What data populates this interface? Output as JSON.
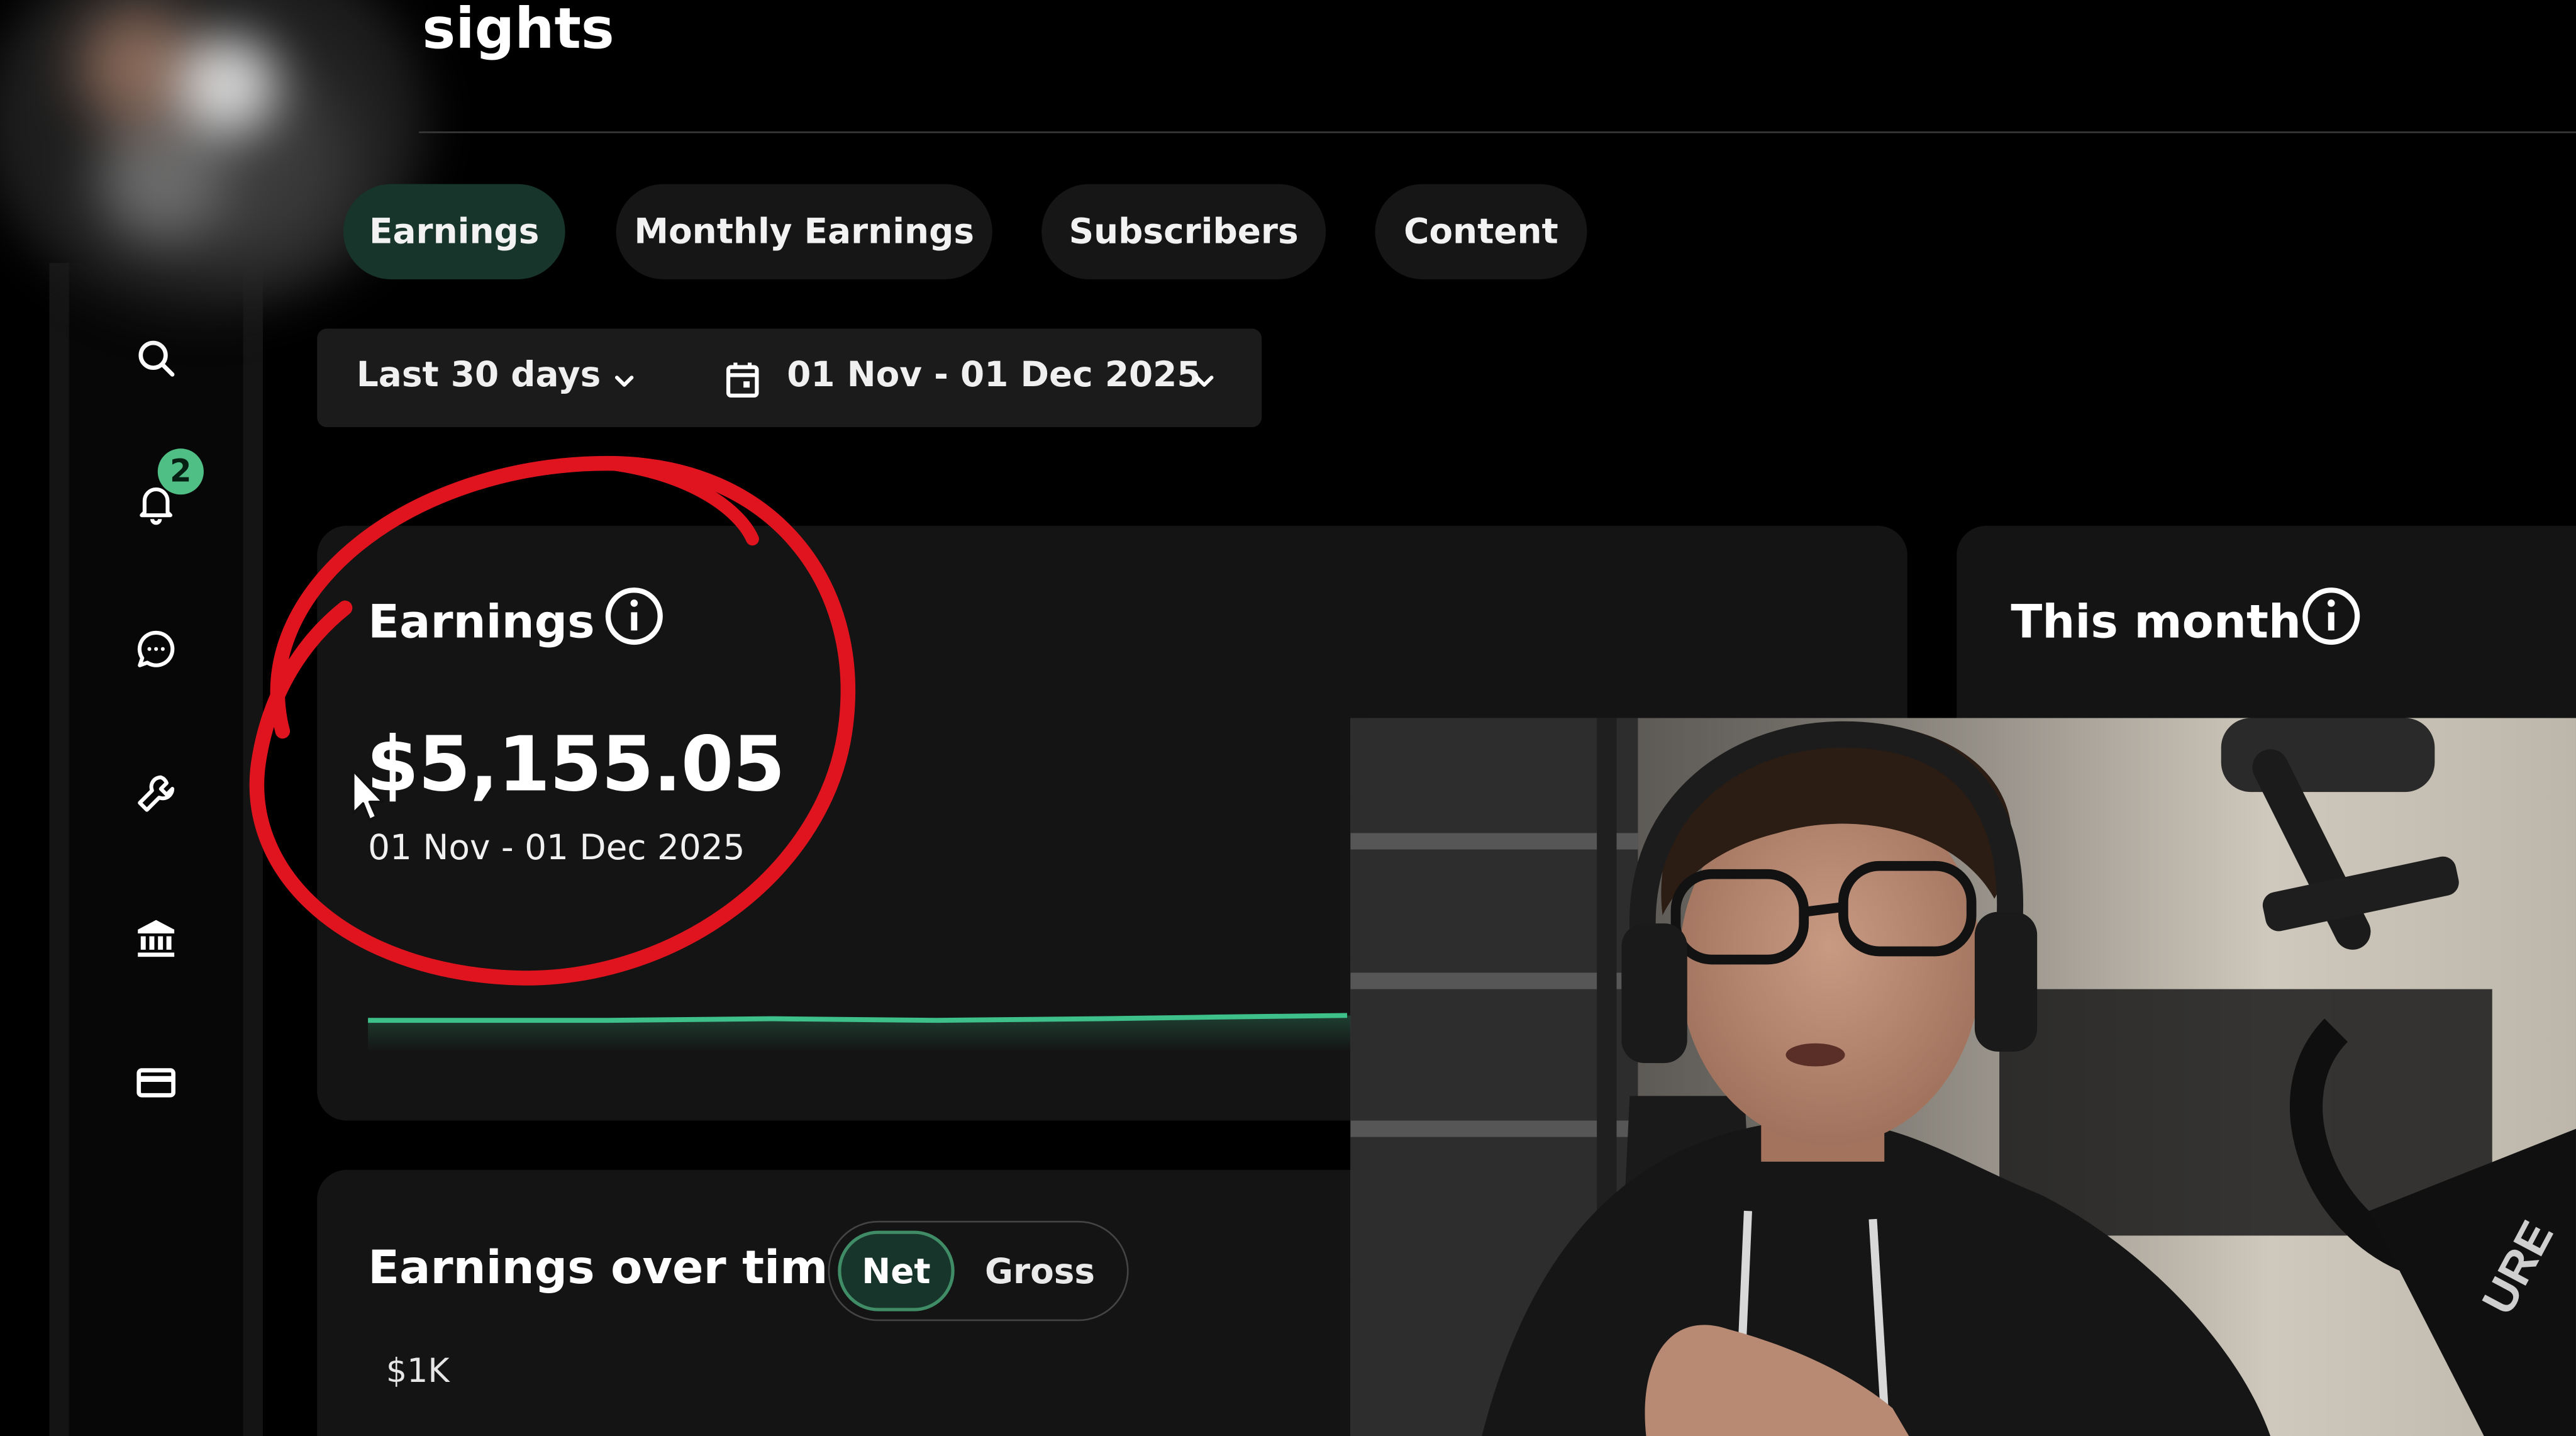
{
  "header": {
    "title": "sights"
  },
  "tabs": [
    {
      "label": "Earnings",
      "active": true
    },
    {
      "label": "Monthly Earnings",
      "active": false
    },
    {
      "label": "Subscribers",
      "active": false
    },
    {
      "label": "Content",
      "active": false
    }
  ],
  "filters": {
    "range_label": "Last 30 days",
    "date_range": "01 Nov - 01 Dec 2025"
  },
  "sidebar": {
    "items": [
      {
        "icon": "search-icon"
      },
      {
        "icon": "bell-icon",
        "badge": "2"
      },
      {
        "icon": "chat-icon"
      },
      {
        "icon": "wrench-icon"
      },
      {
        "icon": "bank-icon"
      },
      {
        "icon": "card-icon"
      }
    ]
  },
  "earnings_card": {
    "title": "Earnings",
    "amount": "$5,155.05",
    "period": "01 Nov - 01 Dec 2025"
  },
  "this_month_card": {
    "title": "This month"
  },
  "earnings_over_time": {
    "title": "Earnings over time",
    "toggle": {
      "net_label": "Net",
      "gross_label": "Gross",
      "selected": "Net"
    },
    "y_tick": "$1K"
  },
  "colors": {
    "accent_green": "#4fbf86",
    "active_tab_bg": "#17352a",
    "annotation_red": "#e0141e",
    "sparkline": "#3ec08a"
  }
}
